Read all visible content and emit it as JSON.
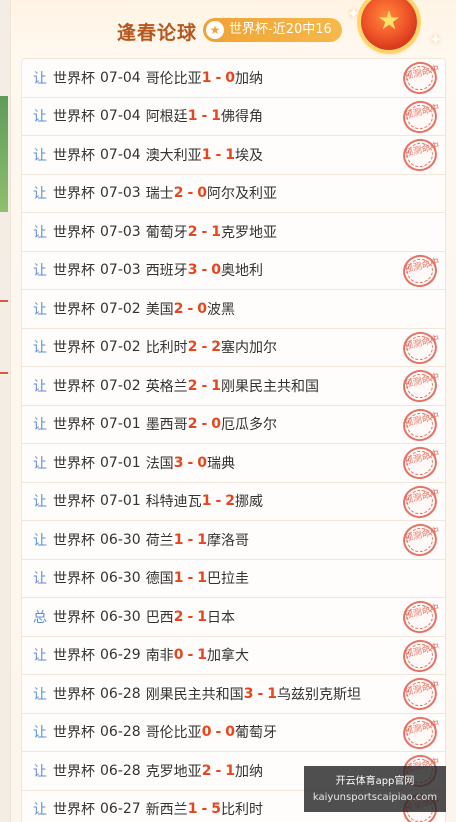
{
  "header": {
    "title": "逢春论球",
    "badge_icon": "star-icon",
    "badge_text": "世界杯-近20中16",
    "medal_icon": "medal-star-icon"
  },
  "stamp_text": "预测命中",
  "matches": [
    {
      "type": "让",
      "league": "世界杯",
      "date": "07-04",
      "home": "哥伦比亚",
      "home_score": "1",
      "away_score": "0",
      "away": "加纳",
      "hit": true
    },
    {
      "type": "让",
      "league": "世界杯",
      "date": "07-04",
      "home": "阿根廷",
      "home_score": "1",
      "away_score": "1",
      "away": "佛得角",
      "hit": true
    },
    {
      "type": "让",
      "league": "世界杯",
      "date": "07-04",
      "home": "澳大利亚",
      "home_score": "1",
      "away_score": "1",
      "away": "埃及",
      "hit": true
    },
    {
      "type": "让",
      "league": "世界杯",
      "date": "07-03",
      "home": "瑞士",
      "home_score": "2",
      "away_score": "0",
      "away": "阿尔及利亚",
      "hit": false
    },
    {
      "type": "让",
      "league": "世界杯",
      "date": "07-03",
      "home": "葡萄牙",
      "home_score": "2",
      "away_score": "1",
      "away": "克罗地亚",
      "hit": false
    },
    {
      "type": "让",
      "league": "世界杯",
      "date": "07-03",
      "home": "西班牙",
      "home_score": "3",
      "away_score": "0",
      "away": "奥地利",
      "hit": true
    },
    {
      "type": "让",
      "league": "世界杯",
      "date": "07-02",
      "home": "美国",
      "home_score": "2",
      "away_score": "0",
      "away": "波黑",
      "hit": false
    },
    {
      "type": "让",
      "league": "世界杯",
      "date": "07-02",
      "home": "比利时",
      "home_score": "2",
      "away_score": "2",
      "away": "塞内加尔",
      "hit": true
    },
    {
      "type": "让",
      "league": "世界杯",
      "date": "07-02",
      "home": "英格兰",
      "home_score": "2",
      "away_score": "1",
      "away": "刚果民主共和国",
      "hit": true
    },
    {
      "type": "让",
      "league": "世界杯",
      "date": "07-01",
      "home": "墨西哥",
      "home_score": "2",
      "away_score": "0",
      "away": "厄瓜多尔",
      "hit": true
    },
    {
      "type": "让",
      "league": "世界杯",
      "date": "07-01",
      "home": "法国",
      "home_score": "3",
      "away_score": "0",
      "away": "瑞典",
      "hit": true
    },
    {
      "type": "让",
      "league": "世界杯",
      "date": "07-01",
      "home": "科特迪瓦",
      "home_score": "1",
      "away_score": "2",
      "away": "挪威",
      "hit": true
    },
    {
      "type": "让",
      "league": "世界杯",
      "date": "06-30",
      "home": "荷兰",
      "home_score": "1",
      "away_score": "1",
      "away": "摩洛哥",
      "hit": true
    },
    {
      "type": "让",
      "league": "世界杯",
      "date": "06-30",
      "home": "德国",
      "home_score": "1",
      "away_score": "1",
      "away": "巴拉圭",
      "hit": false
    },
    {
      "type": "总",
      "league": "世界杯",
      "date": "06-30",
      "home": "巴西",
      "home_score": "2",
      "away_score": "1",
      "away": "日本",
      "hit": true
    },
    {
      "type": "让",
      "league": "世界杯",
      "date": "06-29",
      "home": "南非",
      "home_score": "0",
      "away_score": "1",
      "away": "加拿大",
      "hit": true
    },
    {
      "type": "让",
      "league": "世界杯",
      "date": "06-28",
      "home": "刚果民主共和国",
      "home_score": "3",
      "away_score": "1",
      "away": "乌兹别克斯坦",
      "hit": true
    },
    {
      "type": "让",
      "league": "世界杯",
      "date": "06-28",
      "home": "哥伦比亚",
      "home_score": "0",
      "away_score": "0",
      "away": "葡萄牙",
      "hit": true
    },
    {
      "type": "让",
      "league": "世界杯",
      "date": "06-28",
      "home": "克罗地亚",
      "home_score": "2",
      "away_score": "1",
      "away": "加纳",
      "hit": true
    },
    {
      "type": "让",
      "league": "世界杯",
      "date": "06-27",
      "home": "新西兰",
      "home_score": "1",
      "away_score": "5",
      "away": "比利时",
      "hit": true
    }
  ],
  "watermark": {
    "line1": "开云体育app官网",
    "line2": "kaiyunsportscaipiao.com"
  }
}
